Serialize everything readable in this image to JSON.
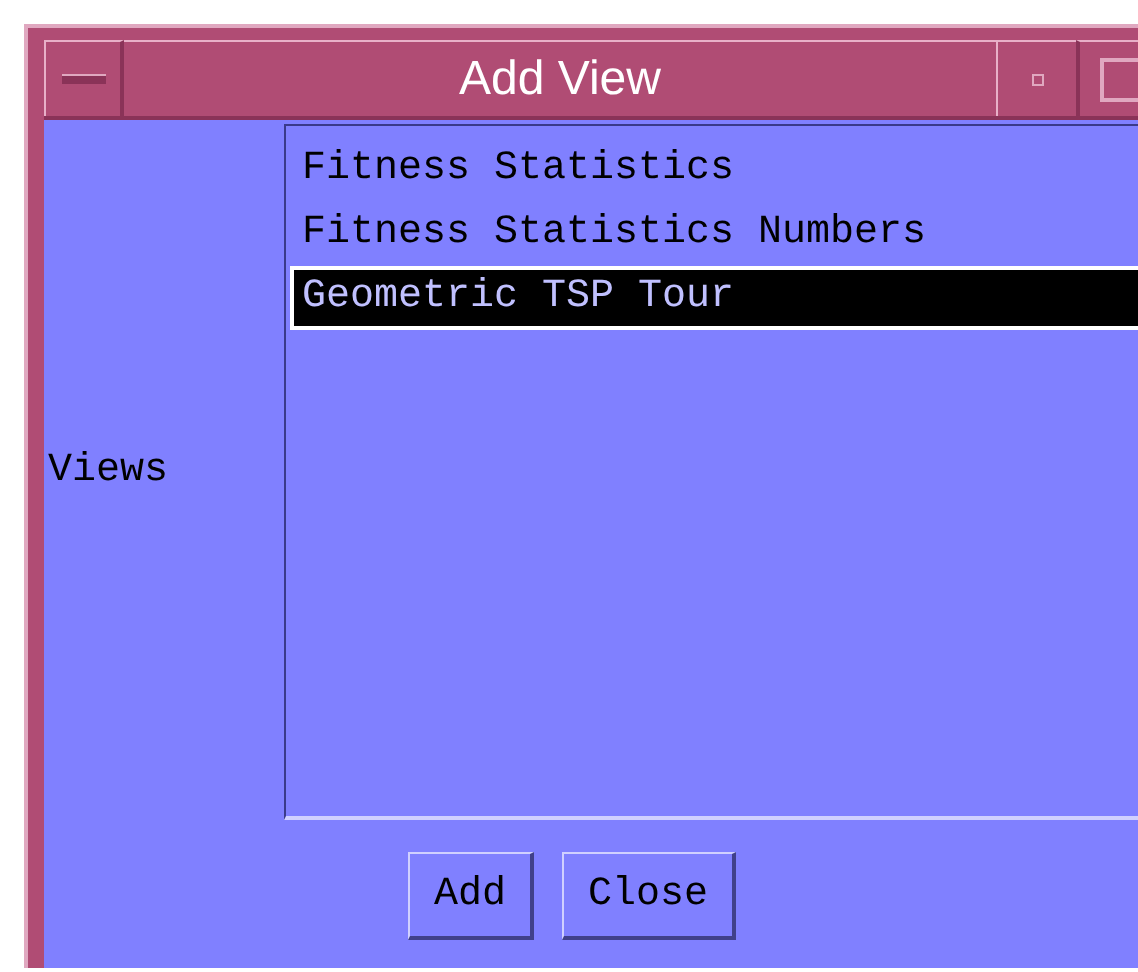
{
  "window": {
    "title": "Add View"
  },
  "views": {
    "label": "Views",
    "items": [
      {
        "label": "Fitness Statistics",
        "selected": false
      },
      {
        "label": "Fitness Statistics Numbers",
        "selected": false
      },
      {
        "label": "Geometric TSP Tour",
        "selected": true
      }
    ]
  },
  "buttons": [
    "Add",
    "Close"
  ]
}
